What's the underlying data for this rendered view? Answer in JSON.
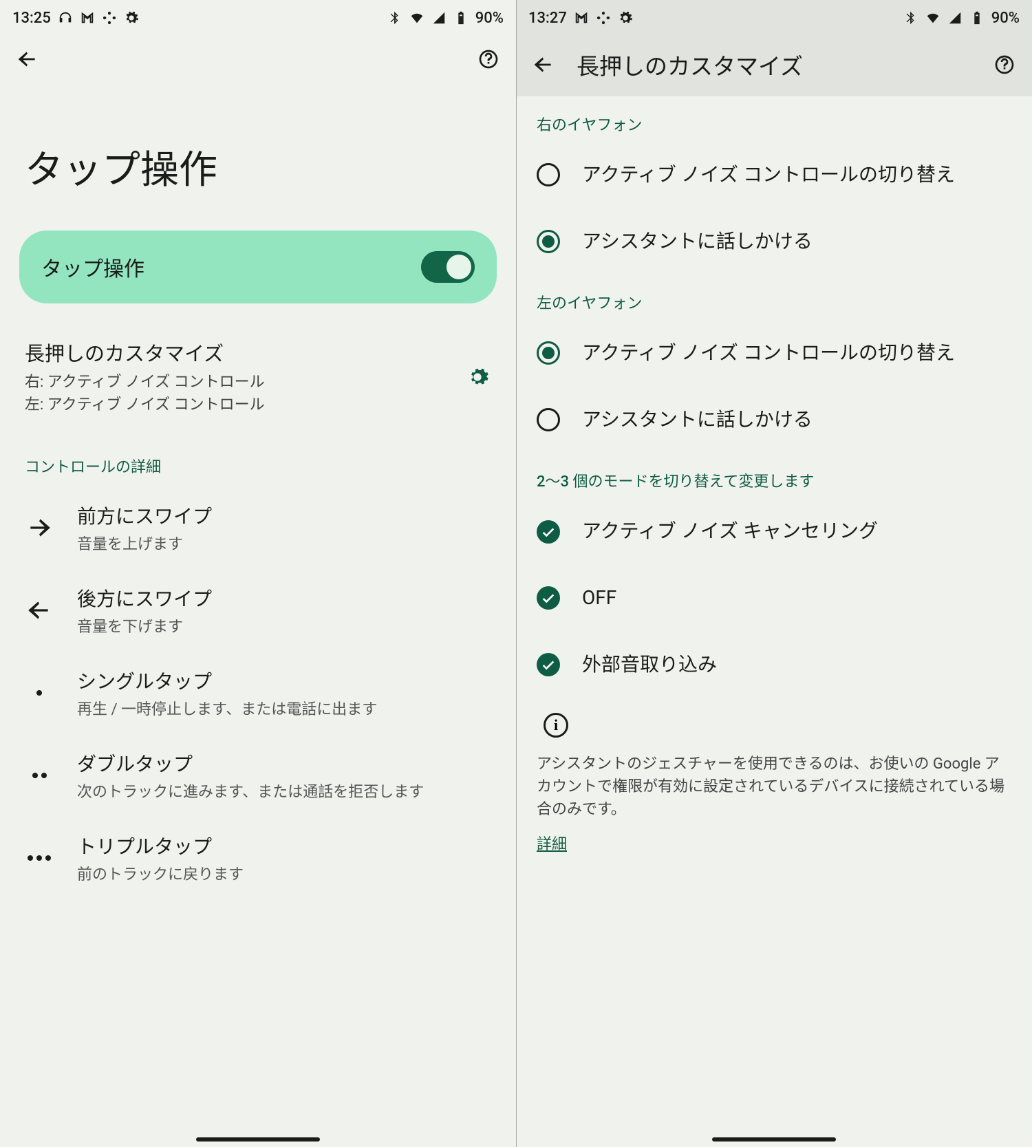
{
  "left": {
    "status": {
      "time": "13:25",
      "battery": "90%"
    },
    "large_title": "タップ操作",
    "toggle": {
      "label": "タップ操作",
      "on": true
    },
    "long_press": {
      "title": "長押しのカスタマイズ",
      "sub1": "右: アクティブ ノイズ コントロール",
      "sub2": "左: アクティブ ノイズ コントロール"
    },
    "section_header": "コントロールの詳細",
    "controls": {
      "swipe_fwd": {
        "title": "前方にスワイプ",
        "sub": "音量を上げます"
      },
      "swipe_back": {
        "title": "後方にスワイプ",
        "sub": "音量を下げます"
      },
      "single_tap": {
        "title": "シングルタップ",
        "sub": "再生 / 一時停止します、または電話に出ます"
      },
      "double_tap": {
        "title": "ダブルタップ",
        "sub": "次のトラックに進みます、または通話を拒否します"
      },
      "triple_tap": {
        "title": "トリプルタップ",
        "sub": "前のトラックに戻ります"
      }
    }
  },
  "right": {
    "status": {
      "time": "13:27",
      "battery": "90%"
    },
    "title": "長押しのカスタマイズ",
    "section_right_earbud": "右のイヤフォン",
    "section_left_earbud": "左のイヤフォン",
    "options": {
      "anc_toggle": "アクティブ ノイズ コントロールの切り替え",
      "talk_assistant": "アシスタントに話しかける"
    },
    "section_modes": "2〜3 個のモードを切り替えて変更します",
    "modes": {
      "anc": "アクティブ ノイズ キャンセリング",
      "off": "OFF",
      "transparency": "外部音取り込み"
    },
    "info_text": "アシスタントのジェスチャーを使用できるのは、お使いの Google アカウントで権限が有効に設定されているデバイスに接続されている場合のみです。",
    "link": "詳細"
  }
}
